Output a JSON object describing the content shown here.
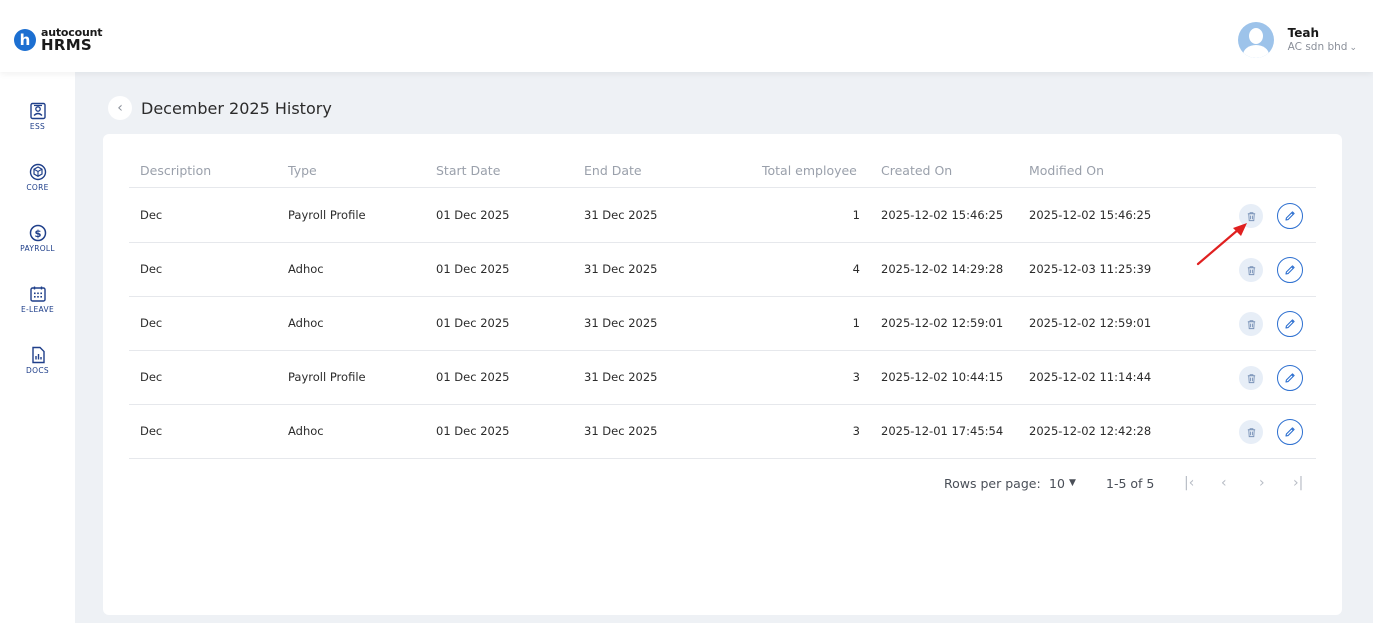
{
  "brand": {
    "top": "autocount",
    "bottom": "HRMS",
    "mark": "h"
  },
  "user": {
    "name": "Teah",
    "company": "AC sdn bhd",
    "caret": "⌄"
  },
  "sidebar": {
    "items": [
      {
        "label": "ESS",
        "icon": "ess-icon"
      },
      {
        "label": "CORE",
        "icon": "core-icon"
      },
      {
        "label": "PAYROLL",
        "icon": "payroll-icon"
      },
      {
        "label": "E-LEAVE",
        "icon": "calendar-icon"
      },
      {
        "label": "DOCS",
        "icon": "docs-icon"
      }
    ]
  },
  "page": {
    "title": "December 2025 History",
    "back": "‹"
  },
  "table": {
    "headers": {
      "description": "Description",
      "type": "Type",
      "start": "Start Date",
      "end": "End Date",
      "total": "Total employee",
      "created": "Created On",
      "modified": "Modified On"
    },
    "rows": [
      {
        "description": "Dec",
        "type": "Payroll Profile",
        "start": "01 Dec 2025",
        "end": "31 Dec 2025",
        "total": "1",
        "created": "2025-12-02 15:46:25",
        "modified": "2025-12-02 15:46:25"
      },
      {
        "description": "Dec",
        "type": "Adhoc",
        "start": "01 Dec 2025",
        "end": "31 Dec 2025",
        "total": "4",
        "created": "2025-12-02 14:29:28",
        "modified": "2025-12-03 11:25:39"
      },
      {
        "description": "Dec",
        "type": "Adhoc",
        "start": "01 Dec 2025",
        "end": "31 Dec 2025",
        "total": "1",
        "created": "2025-12-02 12:59:01",
        "modified": "2025-12-02 12:59:01"
      },
      {
        "description": "Dec",
        "type": "Payroll Profile",
        "start": "01 Dec 2025",
        "end": "31 Dec 2025",
        "total": "3",
        "created": "2025-12-02 10:44:15",
        "modified": "2025-12-02 11:14:44"
      },
      {
        "description": "Dec",
        "type": "Adhoc",
        "start": "01 Dec 2025",
        "end": "31 Dec 2025",
        "total": "3",
        "created": "2025-12-01 17:45:54",
        "modified": "2025-12-02 12:42:28"
      }
    ]
  },
  "pagination": {
    "rows_label": "Rows per page:",
    "rows_value": "10",
    "range": "1-5 of 5",
    "first": "|‹",
    "prev": "‹",
    "next": "›",
    "last": "›|"
  },
  "colors": {
    "accent": "#2c6fd0",
    "annotation_arrow": "#e02020",
    "brand": "#1c6fd1"
  }
}
